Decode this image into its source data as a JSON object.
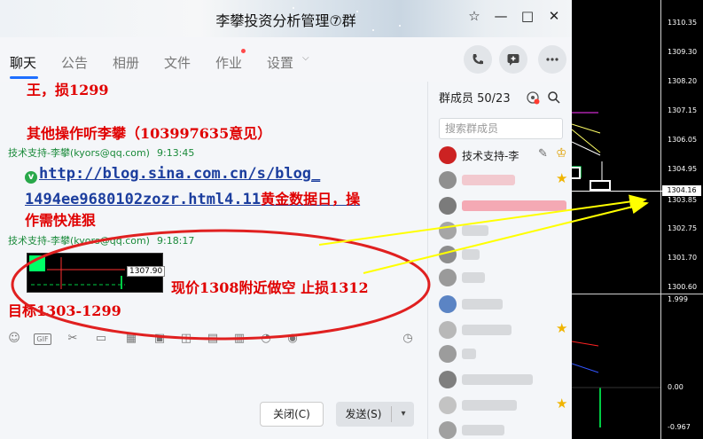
{
  "window": {
    "title": "李攀投资分析管理⑦群",
    "controls": {
      "skin": "☆",
      "minimize": "—",
      "maximize": "□",
      "close": "✕"
    }
  },
  "tabs": [
    {
      "label": "聊天",
      "active": true
    },
    {
      "label": "公告"
    },
    {
      "label": "相册"
    },
    {
      "label": "文件"
    },
    {
      "label": "作业"
    },
    {
      "label": "设置"
    }
  ],
  "messages": {
    "line1": "王，损1299",
    "line2": "其他操作听李攀（103997635意见）",
    "m2_sender": "技术支持-李攀(kyors@qq.com)",
    "m2_time": "9:13:45",
    "link_line1": "http://blog.sina.com.cn/s/blog_",
    "link_line2": "1494ee9680102zozr.html4.11",
    "link_tail": "黄金数据日，操",
    "line_after_link": "作需快准狠",
    "m3_sender": "技术支持-李攀(kyors@qq.com)",
    "m3_time": "9:18:17",
    "thumb_price": "1307.90",
    "advice_line1": "现价1308附近做空 止损1312",
    "advice_line2": "目标1303-1299"
  },
  "composer": {
    "close_label": "关闭(C)",
    "send_label": "发送(S)",
    "gif_label": "GIF"
  },
  "members": {
    "title": "群成员 50/23",
    "search_placeholder": "搜索群成员",
    "first_member": "技术支持-李"
  },
  "colors": {
    "accent": "#1e6fff",
    "message_red": "#e00000",
    "sender_green": "#1a8a3a",
    "annotation_red": "#e02020",
    "arrow_yellow": "#ffff00"
  },
  "chart_panel": {
    "price_ticks": [
      {
        "value": "1310.35",
        "pos": 26
      },
      {
        "value": "1309.30",
        "pos": 59
      },
      {
        "value": "1308.20",
        "pos": 92
      },
      {
        "value": "1307.15",
        "pos": 125
      },
      {
        "value": "1306.05",
        "pos": 158
      },
      {
        "value": "1304.95",
        "pos": 191
      },
      {
        "value": "1303.85",
        "pos": 225
      },
      {
        "value": "1302.75",
        "pos": 258
      },
      {
        "value": "1301.70",
        "pos": 291
      },
      {
        "value": "1300.60",
        "pos": 324
      }
    ],
    "current_price": "1304.16",
    "indicator_ticks": [
      {
        "value": "1.999",
        "pos": 338
      },
      {
        "value": "0.00",
        "pos": 437
      },
      {
        "value": "-0.967",
        "pos": 482
      }
    ]
  }
}
